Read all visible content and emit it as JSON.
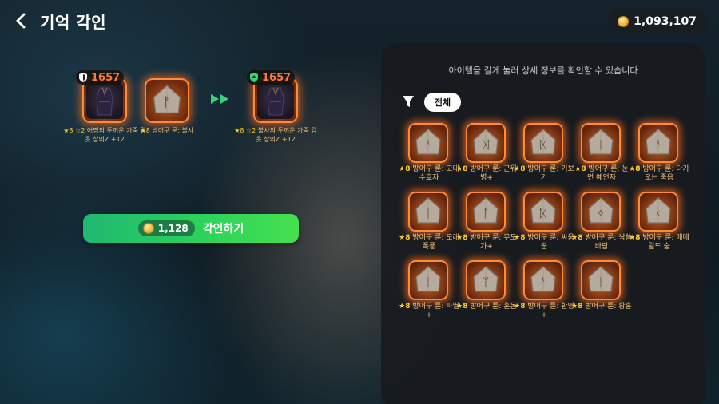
{
  "header": {
    "title": "기억 각인",
    "currency": "1,093,107"
  },
  "preview": {
    "equipment": {
      "level": "1657",
      "caption_prefix": "★8 ☆2",
      "caption": "어명의 두꺼운 가죽 갑옷 상의Z +12"
    },
    "rune": {
      "caption_prefix": "★8",
      "caption": "방어구 룬: 불사"
    },
    "result": {
      "level": "1657",
      "caption_prefix": "★8 ☆2",
      "caption": "불사의 두꺼운 가죽 갑옷 상의Z +12"
    }
  },
  "engrave_button": {
    "cost": "1,128",
    "label": "각인하기"
  },
  "panel": {
    "hint": "아이템을 길게 눌러 상세 정보를 확인할 수 있습니다",
    "filter_label": "전체",
    "runes": [
      {
        "star": "★8",
        "name": "방어구 룬: 고대 수호자",
        "glyph": "ᚨ"
      },
      {
        "star": "★8",
        "name": "방어구 룬: 근위병+",
        "glyph": "ᛞ"
      },
      {
        "star": "★8",
        "name": "방어구 룬: 기보기",
        "glyph": "ᛞ"
      },
      {
        "star": "★8",
        "name": "방어구 룬: 눈 먼 예언자",
        "glyph": "ᛁ"
      },
      {
        "star": "★8",
        "name": "방어구 룬: 다가오는 죽음",
        "glyph": "ᚨ"
      },
      {
        "star": "★8",
        "name": "방어구 룬: 모래 폭풍",
        "glyph": "ᛁ"
      },
      {
        "star": "★8",
        "name": "방어구 룬: 무도가+",
        "glyph": "ᛚ"
      },
      {
        "star": "★8",
        "name": "방어구 룬: 싸움꾼",
        "glyph": "ᛞ"
      },
      {
        "star": "★8",
        "name": "방어구 룬: 싹쓸바람",
        "glyph": "ᛜ"
      },
      {
        "star": "★8",
        "name": "방어구 룬: 메메릴드 숲",
        "glyph": "ᚲ"
      },
      {
        "star": "★8",
        "name": "방어구 룬: 파멸+",
        "glyph": "ᛁ"
      },
      {
        "star": "★8",
        "name": "방어구 룬: 혼돈",
        "glyph": "ᛉ"
      },
      {
        "star": "★8",
        "name": "방어구 룬: 환영+",
        "glyph": "ᚨ"
      },
      {
        "star": "★8",
        "name": "방어구 룬: 황혼",
        "glyph": "ᛁ"
      }
    ]
  }
}
